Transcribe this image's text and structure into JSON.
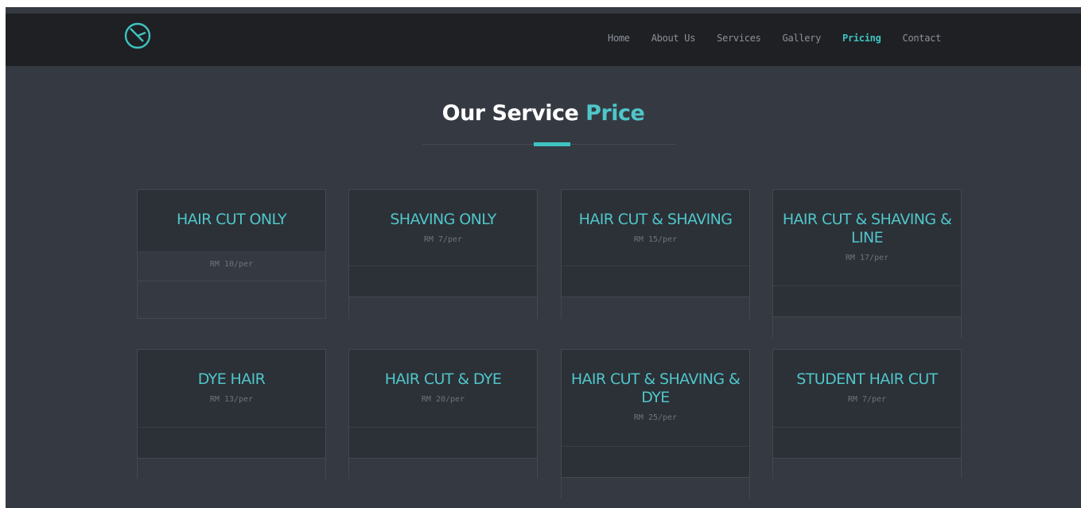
{
  "nav": {
    "items": [
      {
        "label": "Home",
        "active": false
      },
      {
        "label": "About Us",
        "active": false
      },
      {
        "label": "Services",
        "active": false
      },
      {
        "label": "Gallery",
        "active": false
      },
      {
        "label": "Pricing",
        "active": true
      },
      {
        "label": "Contact",
        "active": false
      }
    ],
    "logo_icon": "circle-slash-logo-icon"
  },
  "section": {
    "title_main": "Our Service ",
    "title_accent": "Price"
  },
  "colors": {
    "accent": "#3fc3c0",
    "background": "#353a42",
    "navbar": "#1e2024",
    "card_head": "#2c3037"
  },
  "cards": [
    {
      "name": "HAIR CUT ONLY",
      "price": "RM 10/per"
    },
    {
      "name": "SHAVING ONLY",
      "price": "RM 7/per"
    },
    {
      "name": "HAIR CUT & SHAVING",
      "price": "RM 15/per"
    },
    {
      "name": "HAIR CUT & SHAVING & LINE",
      "price": "RM 17/per"
    },
    {
      "name": "DYE HAIR",
      "price": "RM 13/per"
    },
    {
      "name": "HAIR CUT & DYE",
      "price": "RM 20/per"
    },
    {
      "name": "HAIR CUT & SHAVING & DYE",
      "price": "RM 25/per"
    },
    {
      "name": "STUDENT HAIR CUT",
      "price": "RM 7/per"
    }
  ]
}
